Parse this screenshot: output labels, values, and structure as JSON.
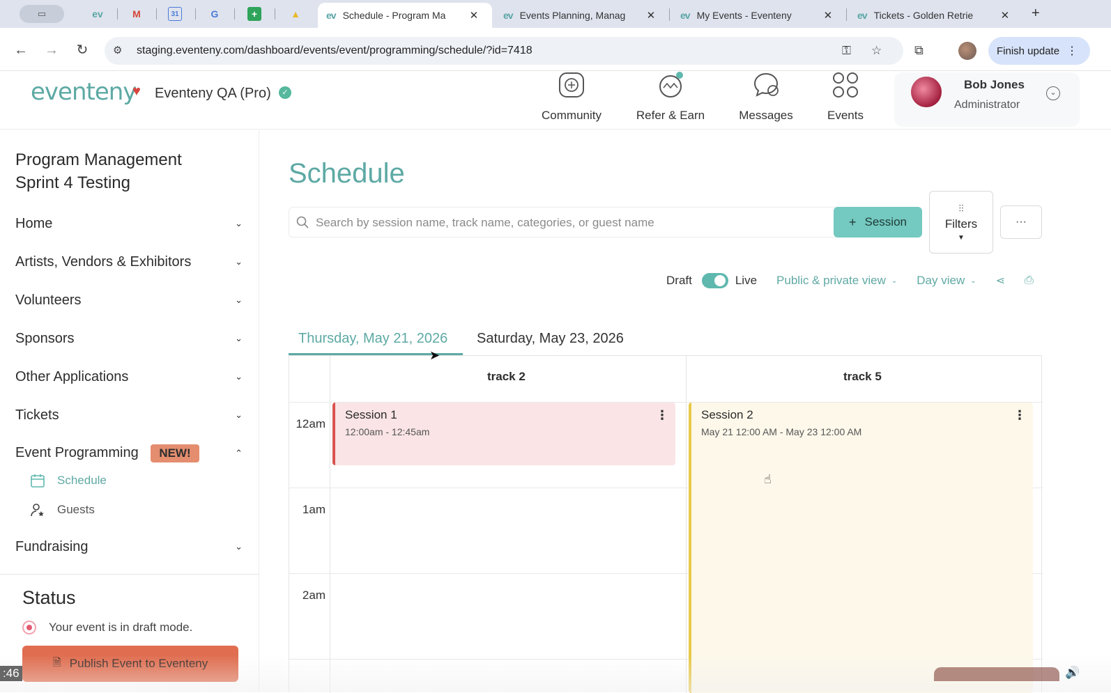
{
  "browser": {
    "pinned_tabs": [
      {
        "icon": "eventeny-icon",
        "glyph": "ev"
      },
      {
        "icon": "gmail-icon",
        "glyph": "M"
      },
      {
        "icon": "calendar-icon",
        "glyph": "31"
      },
      {
        "icon": "translate-icon",
        "glyph": "G"
      },
      {
        "icon": "sheets-icon",
        "glyph": "+"
      },
      {
        "icon": "drive-icon",
        "glyph": "▲"
      }
    ],
    "tabs": [
      {
        "title": "Schedule - Program Ma",
        "active": true
      },
      {
        "title": "Events Planning, Manag",
        "active": false
      },
      {
        "title": "My Events - Eventeny",
        "active": false
      },
      {
        "title": "Tickets - Golden Retrie",
        "active": false
      }
    ],
    "tab_favicon": "ev",
    "url": "staging.eventeny.com/dashboard/events/event/programming/schedule/?id=7418",
    "finish_update_label": "Finish update"
  },
  "header": {
    "logo_text": "eventeny",
    "org_name": "Eventeny QA (Pro)",
    "nav": [
      {
        "label": "Community",
        "icon": "community-icon"
      },
      {
        "label": "Refer & Earn",
        "icon": "refer-earn-icon"
      },
      {
        "label": "Messages",
        "icon": "messages-icon"
      },
      {
        "label": "Events",
        "icon": "events-grid-icon"
      }
    ],
    "user": {
      "name": "Bob Jones",
      "role": "Administrator"
    }
  },
  "sidebar": {
    "event_title": "Program Management Sprint 4 Testing",
    "menu": [
      {
        "label": "Home",
        "expanded": false
      },
      {
        "label": "Artists, Vendors & Exhibitors",
        "expanded": false
      },
      {
        "label": "Volunteers",
        "expanded": false
      },
      {
        "label": "Sponsors",
        "expanded": false
      },
      {
        "label": "Other Applications",
        "expanded": false
      },
      {
        "label": "Tickets",
        "expanded": false
      },
      {
        "label": "Event Programming",
        "expanded": true,
        "badge": "NEW!"
      },
      {
        "label": "Fundraising",
        "expanded": false
      }
    ],
    "submenu": [
      {
        "label": "Schedule",
        "icon": "calendar-icon",
        "active": true
      },
      {
        "label": "Guests",
        "icon": "guest-icon",
        "active": false
      }
    ],
    "status": {
      "title": "Status",
      "text": "Your event is in draft mode.",
      "publish_label": "Publish Event to Eventeny"
    }
  },
  "main": {
    "title": "Schedule",
    "search_placeholder": "Search by session name, track name, categories, or guest name",
    "add_session_label": "Session",
    "filters_label": "Filters",
    "more_label": "···",
    "draft_label": "Draft",
    "live_label": "Live",
    "view_visibility": "Public & private view",
    "view_mode": "Day view",
    "day_tabs": [
      {
        "label": "Thursday, May 21, 2026",
        "active": true
      },
      {
        "label": "Saturday, May 23, 2026",
        "active": false
      }
    ],
    "tracks": [
      "track 2",
      "track 5"
    ],
    "time_labels": [
      "12am",
      "1am",
      "2am"
    ],
    "sessions": [
      {
        "title": "Session 1",
        "time": "12:00am - 12:45am",
        "track": "track 2",
        "color": "#d9534f"
      },
      {
        "title": "Session 2",
        "time": "May 21 12:00 AM - May 23 12:00 AM",
        "track": "track 5",
        "color": "#e8c94a"
      }
    ]
  },
  "video": {
    "timecode": ":46"
  },
  "colors": {
    "brand": "#5da9a4",
    "accent_button": "#74c9c0",
    "publish": "#e06d4f",
    "badge": "#e48d6f"
  }
}
